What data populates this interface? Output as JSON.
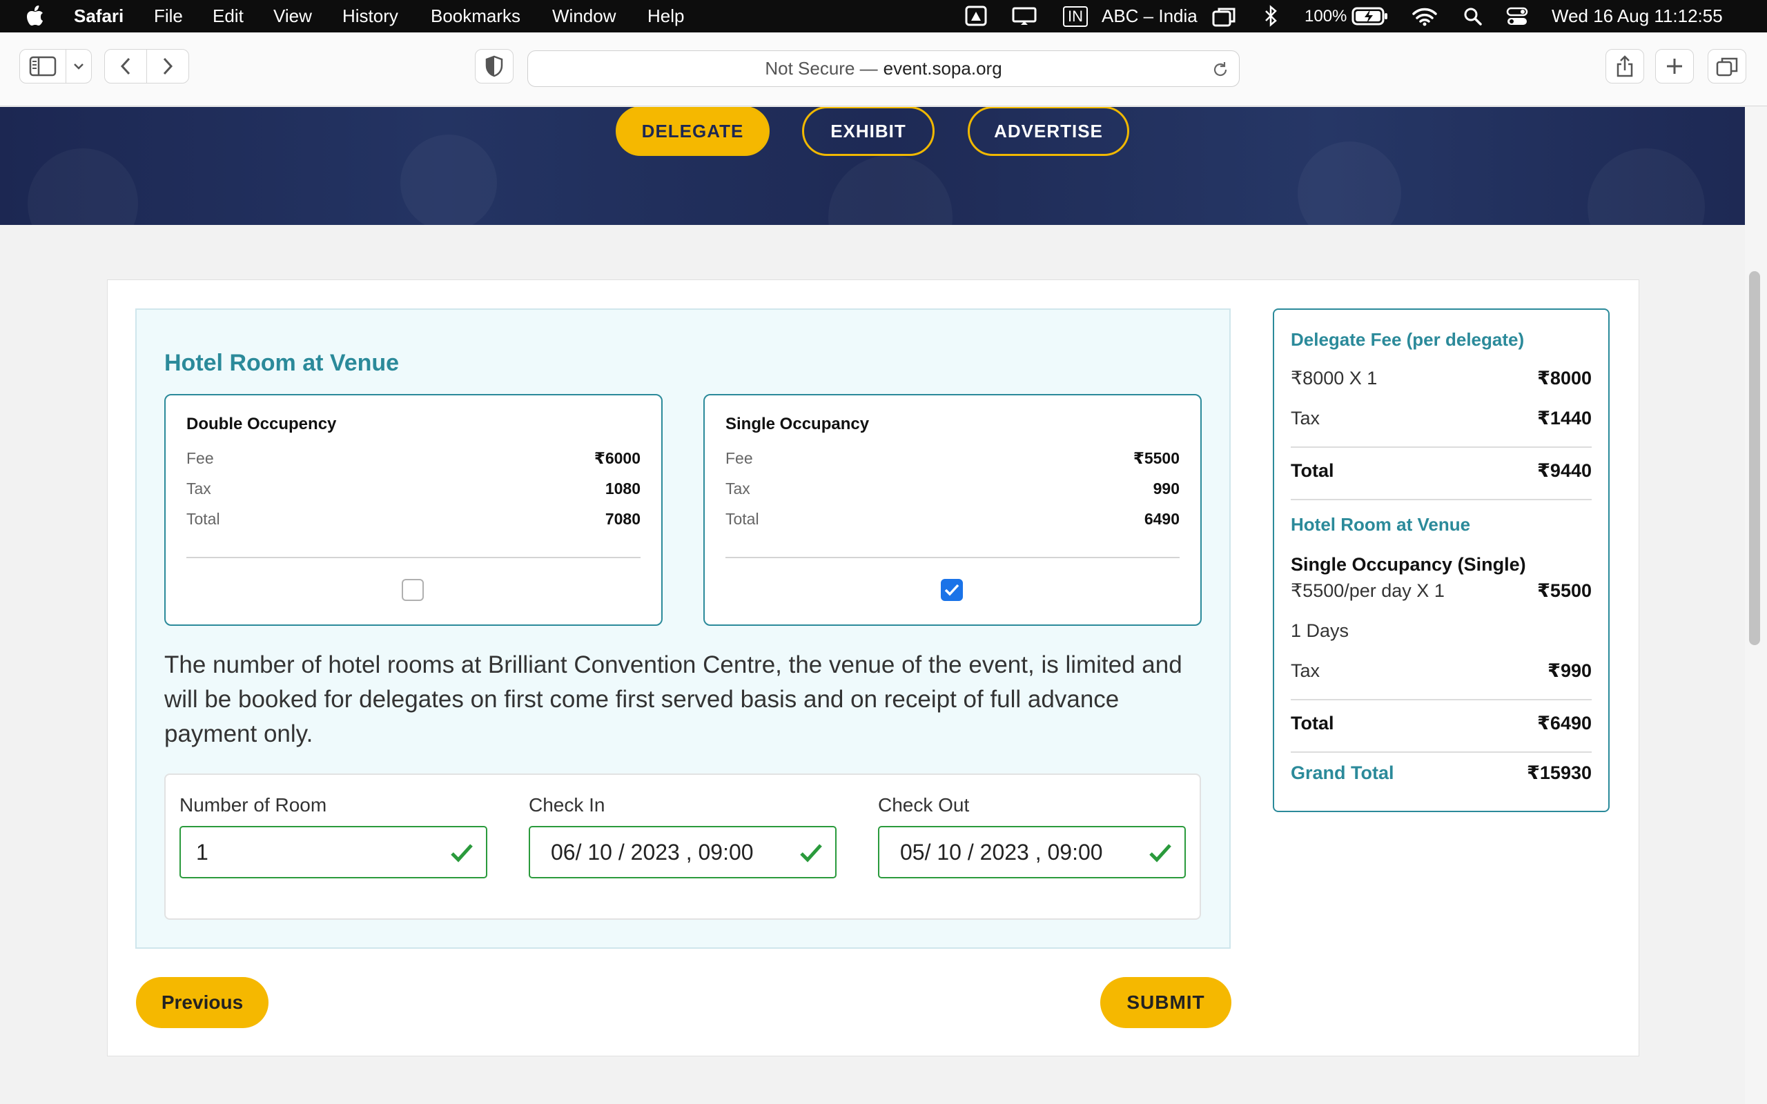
{
  "menubar": {
    "app": "Safari",
    "items": [
      "File",
      "Edit",
      "View",
      "History",
      "Bookmarks",
      "Window",
      "Help"
    ],
    "input_source": "IN",
    "keyboard": "ABC – India",
    "battery": "100%",
    "clock": "Wed 16 Aug  11:12:55"
  },
  "browser": {
    "url_prefix": "Not Secure —",
    "url_host": "event.sopa.org"
  },
  "nav": {
    "delegate": "DELEGATE",
    "exhibit": "EXHIBIT",
    "advertise": "ADVERTISE"
  },
  "hotel": {
    "title": "Hotel Room at Venue",
    "options": [
      {
        "name": "Double Occupency",
        "fee_label": "Fee",
        "fee": "₹6000",
        "tax_label": "Tax",
        "tax": "1080",
        "total_label": "Total",
        "total": "7080",
        "checked": false
      },
      {
        "name": "Single Occupancy",
        "fee_label": "Fee",
        "fee": "₹5500",
        "tax_label": "Tax",
        "tax": "990",
        "total_label": "Total",
        "total": "6490",
        "checked": true
      }
    ],
    "note": "The number of hotel rooms at Brilliant Convention Centre, the venue of the event, is limited and will be booked for delegates on first come first served basis and on receipt of full advance payment only.",
    "form": {
      "rooms_label": "Number of Room",
      "rooms_value": "1",
      "checkin_label": "Check In",
      "checkin_value": "06/ 10 / 2023 , 09:00",
      "checkout_label": "Check Out",
      "checkout_value": "05/ 10 / 2023 , 09:00"
    }
  },
  "summary": {
    "delegate_title": "Delegate Fee (per delegate)",
    "delegate_qty": "₹8000 X 1",
    "delegate_amount": "₹8000",
    "delegate_tax_label": "Tax",
    "delegate_tax": "₹1440",
    "delegate_total_label": "Total",
    "delegate_total": "₹9440",
    "hotel_title": "Hotel Room at Venue",
    "hotel_type": "Single Occupancy (Single)",
    "hotel_rate": "₹5500/per day X 1",
    "hotel_amount": "₹5500",
    "hotel_days": "1 Days",
    "hotel_tax_label": "Tax",
    "hotel_tax": "₹990",
    "hotel_total_label": "Total",
    "hotel_total": "₹6490",
    "grand_label": "Grand Total",
    "grand_total": "₹15930"
  },
  "buttons": {
    "previous": "Previous",
    "submit": "SUBMIT"
  },
  "colors": {
    "accent_yellow": "#f5b800",
    "teal": "#2b8a9a",
    "banner_navy": "#1c2752",
    "valid_green": "#2a9a3c",
    "checkbox_blue": "#1a73e8"
  }
}
